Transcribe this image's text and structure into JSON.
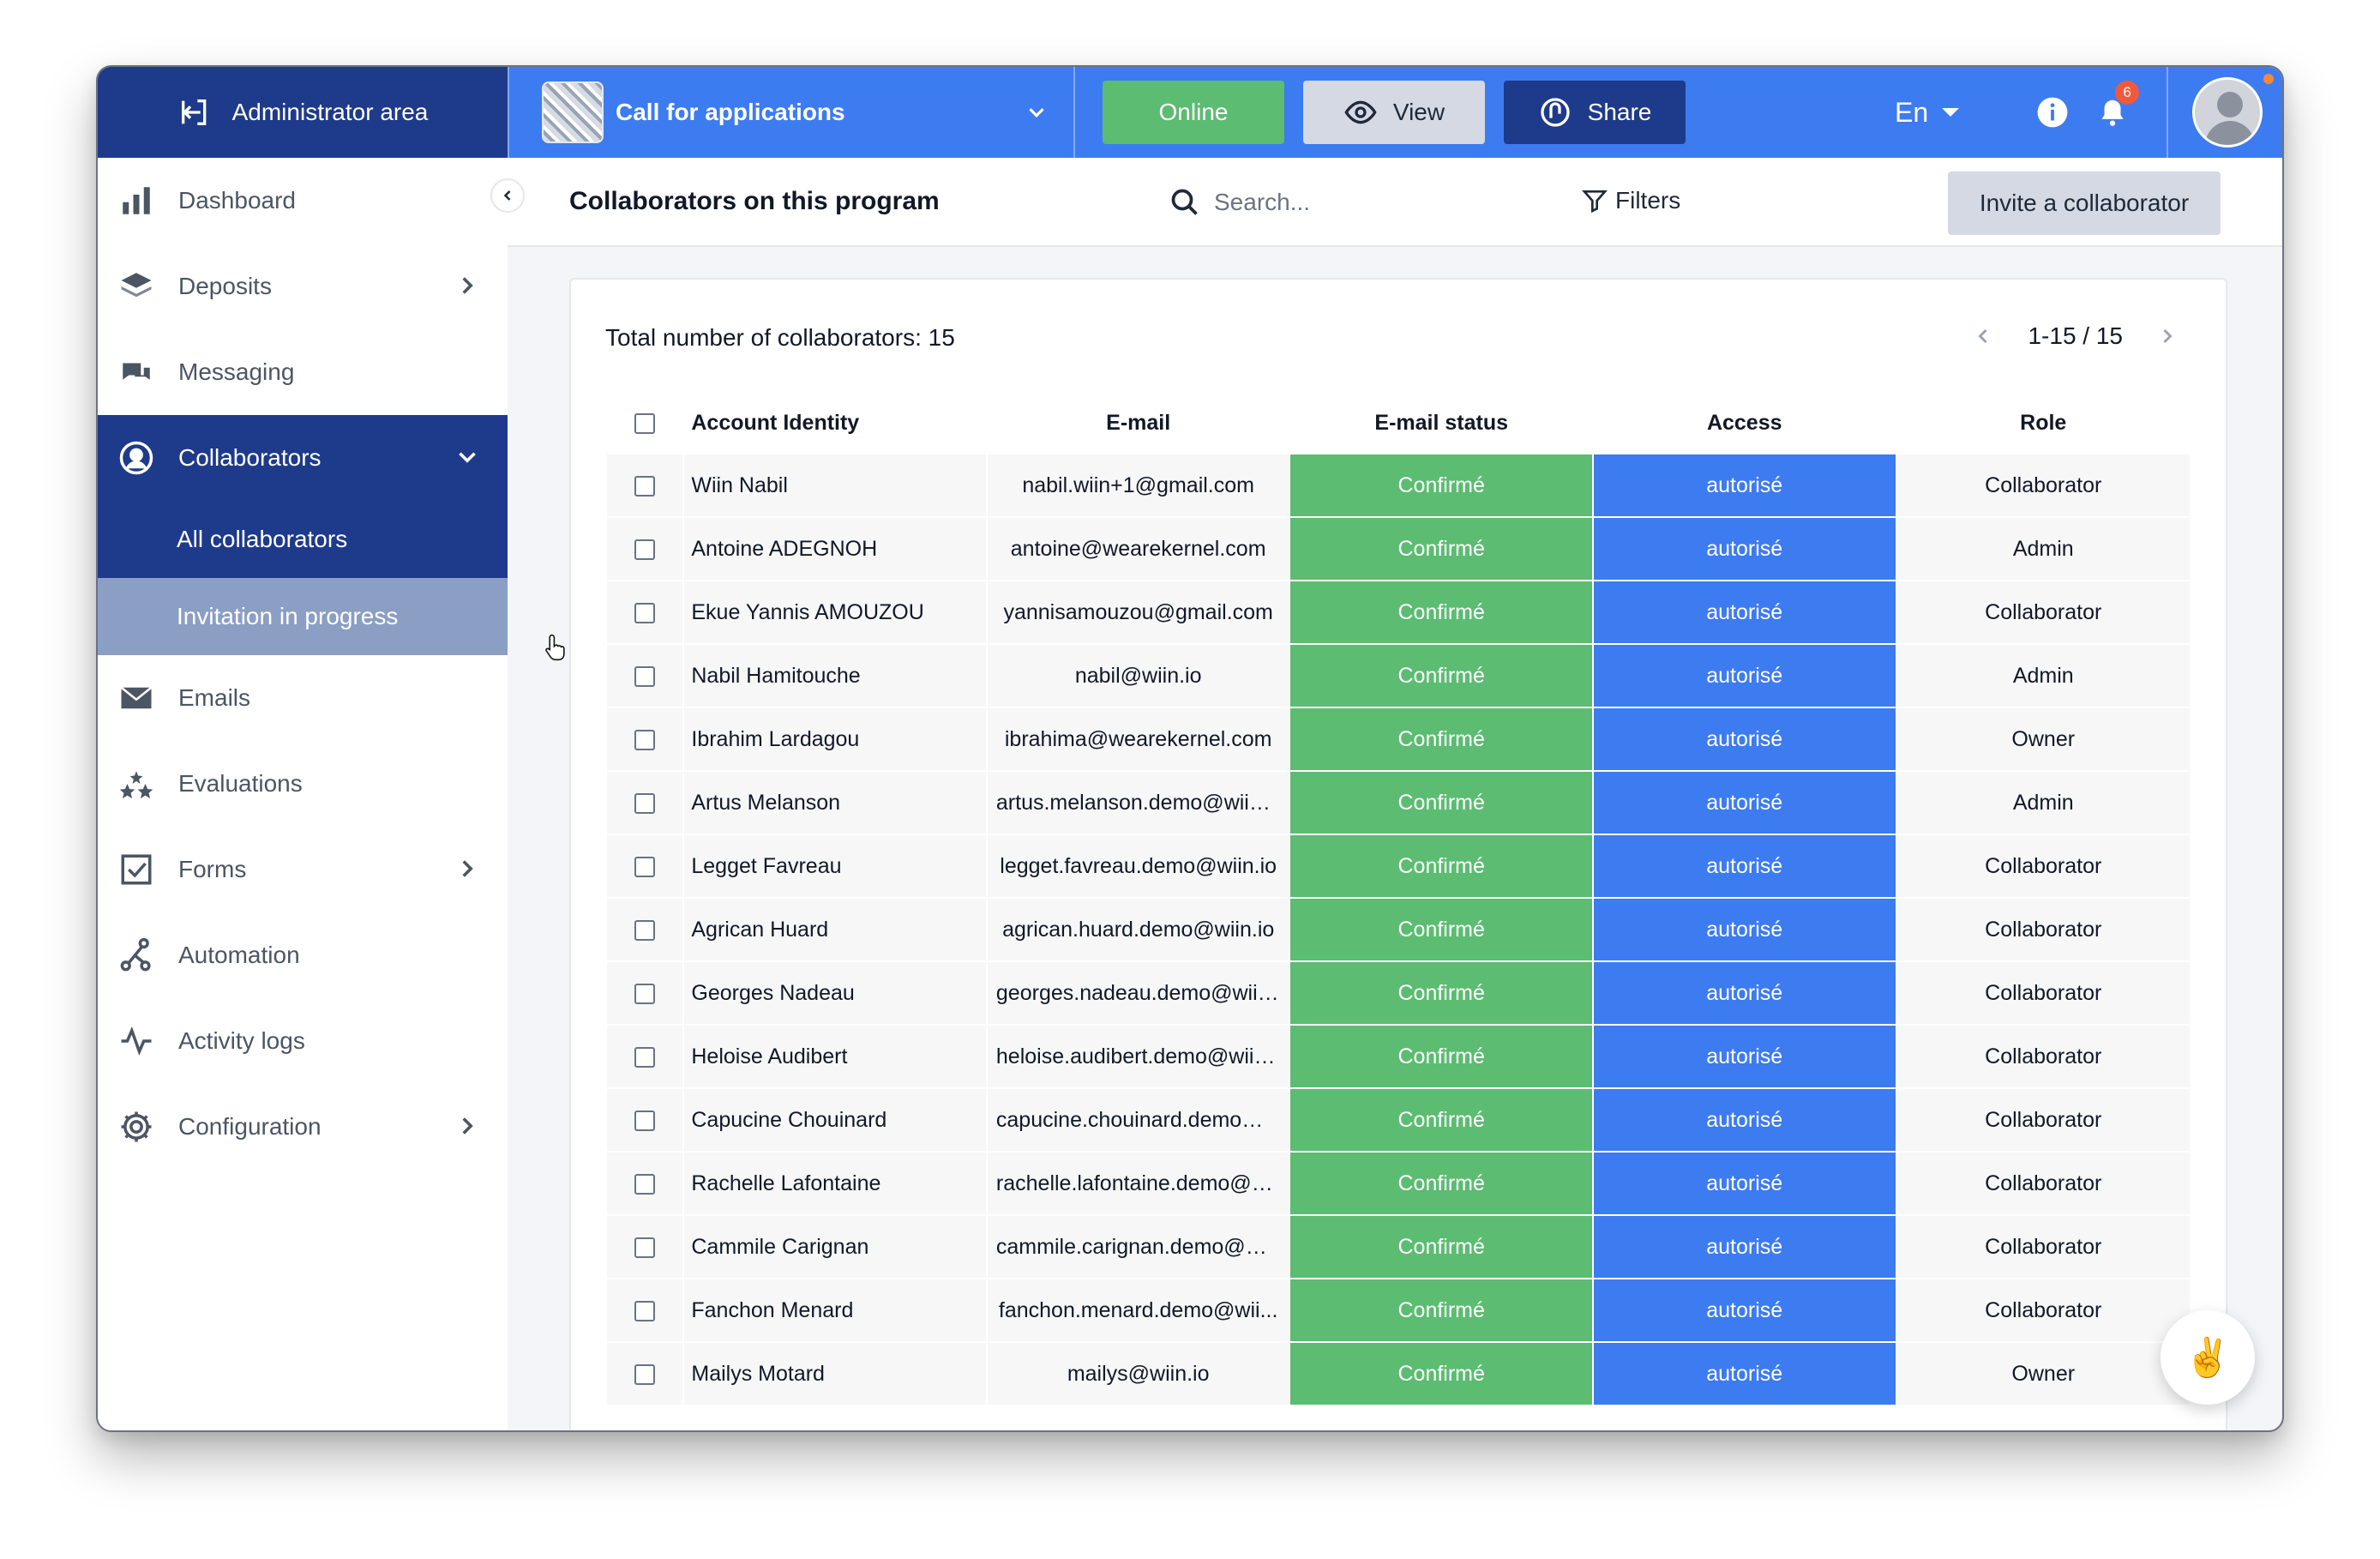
{
  "topbar": {
    "admin_area": "Administrator area",
    "program_title": "Call for applications",
    "online_label": "Online",
    "view_label": "View",
    "share_label": "Share",
    "language": "En",
    "notification_count": "6"
  },
  "sidebar": {
    "items": [
      {
        "label": "Dashboard",
        "icon": "bar-chart-icon"
      },
      {
        "label": "Deposits",
        "icon": "layers-icon"
      },
      {
        "label": "Messaging",
        "icon": "chat-icon"
      },
      {
        "label": "Collaborators",
        "icon": "user-circle-icon"
      },
      {
        "label": "Emails",
        "icon": "envelope-icon"
      },
      {
        "label": "Evaluations",
        "icon": "stars-icon"
      },
      {
        "label": "Forms",
        "icon": "checkbox-icon"
      },
      {
        "label": "Automation",
        "icon": "automation-icon"
      },
      {
        "label": "Activity logs",
        "icon": "activity-icon"
      },
      {
        "label": "Configuration",
        "icon": "gear-icon"
      }
    ],
    "collaborators_sub": {
      "all": "All collaborators",
      "invitation": "Invitation in progress"
    }
  },
  "main": {
    "title": "Collaborators on this program",
    "search_placeholder": "Search...",
    "filters_label": "Filters",
    "invite_label": "Invite a collaborator",
    "total_label": "Total number of collaborators: 15",
    "pagination": "1-15 / 15",
    "columns": [
      "Account Identity",
      "E-mail",
      "E-mail status",
      "Access",
      "Role"
    ],
    "rows": [
      {
        "name": "Wiin Nabil",
        "email": "nabil.wiin+1@gmail.com",
        "status": "Confirmé",
        "access": "autorisé",
        "role": "Collaborator"
      },
      {
        "name": "Antoine ADEGNOH",
        "email": "antoine@wearekernel.com",
        "status": "Confirmé",
        "access": "autorisé",
        "role": "Admin"
      },
      {
        "name": "Ekue Yannis AMOUZOU",
        "email": "yannisamouzou@gmail.com",
        "status": "Confirmé",
        "access": "autorisé",
        "role": "Collaborator"
      },
      {
        "name": "Nabil Hamitouche",
        "email": "nabil@wiin.io",
        "status": "Confirmé",
        "access": "autorisé",
        "role": "Admin"
      },
      {
        "name": "Ibrahim Lardagou",
        "email": "ibrahima@wearekernel.com",
        "status": "Confirmé",
        "access": "autorisé",
        "role": "Owner"
      },
      {
        "name": "Artus Melanson",
        "email": "artus.melanson.demo@wiin....",
        "status": "Confirmé",
        "access": "autorisé",
        "role": "Admin"
      },
      {
        "name": "Legget Favreau",
        "email": "legget.favreau.demo@wiin.io",
        "status": "Confirmé",
        "access": "autorisé",
        "role": "Collaborator"
      },
      {
        "name": "Agrican Huard",
        "email": "agrican.huard.demo@wiin.io",
        "status": "Confirmé",
        "access": "autorisé",
        "role": "Collaborator"
      },
      {
        "name": "Georges Nadeau",
        "email": "georges.nadeau.demo@wiin...",
        "status": "Confirmé",
        "access": "autorisé",
        "role": "Collaborator"
      },
      {
        "name": "Heloise Audibert",
        "email": "heloise.audibert.demo@wiin...",
        "status": "Confirmé",
        "access": "autorisé",
        "role": "Collaborator"
      },
      {
        "name": "Capucine Chouinard",
        "email": "capucine.chouinard.demo@...",
        "status": "Confirmé",
        "access": "autorisé",
        "role": "Collaborator"
      },
      {
        "name": "Rachelle Lafontaine",
        "email": "rachelle.lafontaine.demo@w...",
        "status": "Confirmé",
        "access": "autorisé",
        "role": "Collaborator"
      },
      {
        "name": "Cammile Carignan",
        "email": "cammile.carignan.demo@wi...",
        "status": "Confirmé",
        "access": "autorisé",
        "role": "Collaborator"
      },
      {
        "name": "Fanchon Menard",
        "email": "fanchon.menard.demo@wii...",
        "status": "Confirmé",
        "access": "autorisé",
        "role": "Collaborator"
      },
      {
        "name": "Mailys Motard",
        "email": "mailys@wiin.io",
        "status": "Confirmé",
        "access": "autorisé",
        "role": "Owner"
      }
    ]
  },
  "colors": {
    "primary_blue": "#3d7bf0",
    "dark_blue": "#1e3a8a",
    "green": "#5cbc72",
    "sub_selected": "#8b9ec4"
  },
  "fab_icon": "victory-hand-icon"
}
